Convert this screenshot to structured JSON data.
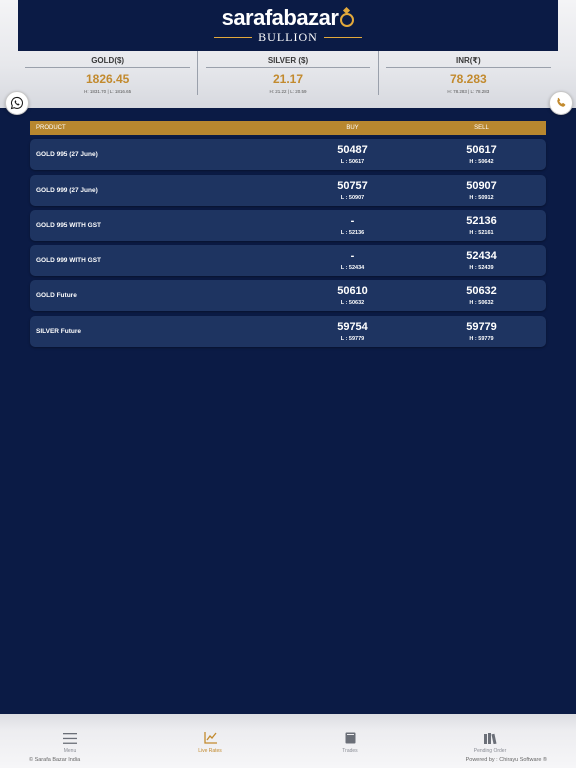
{
  "brand": {
    "name_part1": "sarafa",
    "name_part2": "bazar",
    "tagline": "BULLION"
  },
  "colors": {
    "background": "#0b1b45",
    "gold_accent": "#c28a2e",
    "table_header": "#b8872f",
    "row_bg": "#1e3461"
  },
  "rates": [
    {
      "label": "GOLD($)",
      "value": "1826.45",
      "hl": "H: 1831.70 | L: 1816.65"
    },
    {
      "label": "SILVER ($)",
      "value": "21.17",
      "hl": "H: 21.22 | L: 20.59"
    },
    {
      "label": "INR(₹)",
      "value": "78.283",
      "hl": "H: 78.283 | L: 78.283"
    }
  ],
  "floating": {
    "left_icon": "whatsapp-icon",
    "right_icon": "phone-icon"
  },
  "table": {
    "headers": {
      "product": "PRODUCT",
      "buy": "BUY",
      "sell": "SELL"
    },
    "rows": [
      {
        "product": "GOLD 995 (27 June)",
        "buy": "50487",
        "buy_sub": "L : 50617",
        "sell": "50617",
        "sell_sub": "H : 50642"
      },
      {
        "product": "GOLD 999 (27 June)",
        "buy": "50757",
        "buy_sub": "L : 50907",
        "sell": "50907",
        "sell_sub": "H : 50912"
      },
      {
        "product": "GOLD 995 WITH GST",
        "buy": "-",
        "buy_sub": "L : 52136",
        "sell": "52136",
        "sell_sub": "H : 52161"
      },
      {
        "product": "GOLD 999 WITH GST",
        "buy": "-",
        "buy_sub": "L : 52434",
        "sell": "52434",
        "sell_sub": "H : 52439"
      },
      {
        "product": "GOLD Future",
        "buy": "50610",
        "buy_sub": "L : 50632",
        "sell": "50632",
        "sell_sub": "H : 50632"
      },
      {
        "product": "SILVER Future",
        "buy": "59754",
        "buy_sub": "L : 59779",
        "sell": "59779",
        "sell_sub": "H : 59779"
      }
    ]
  },
  "nav": [
    {
      "label": "Menu",
      "icon": "menu-icon",
      "active": false
    },
    {
      "label": "Live Rates",
      "icon": "line-chart-icon",
      "active": true
    },
    {
      "label": "Trades",
      "icon": "book-icon",
      "active": false
    },
    {
      "label": "Pending Order",
      "icon": "library-icon",
      "active": false
    }
  ],
  "footer": {
    "copyright": "© Sarafa Bazar India",
    "powered": "Powered by : Chirayu Software ®"
  }
}
